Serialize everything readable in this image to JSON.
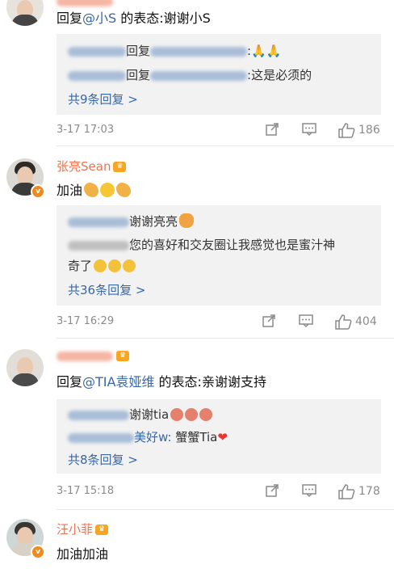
{
  "comments": [
    {
      "username": "",
      "text_prefix": "回复",
      "mention": "@小S",
      "text_suffix": " 的表态:谢谢小S",
      "replies": [
        {
          "name_label": "回复",
          "text": ":🙏🙏"
        },
        {
          "name_label": "回复",
          "text": ":这是必须的"
        }
      ],
      "more_link": "共9条回复 >",
      "timestamp": "3-17 17:03",
      "likes": "186"
    },
    {
      "username": "张亮Sean",
      "text": "加油",
      "replies": [
        {
          "text": "谢谢亮亮"
        },
        {
          "text": "您的喜好和交友圈让我感觉也是蜜汁神",
          "text2": "奇了"
        }
      ],
      "more_link": "共36条回复 >",
      "timestamp": "3-17 16:29",
      "likes": "404"
    },
    {
      "username": "",
      "text_prefix": "回复",
      "mention": "@TIA袁娅维",
      "text_suffix": " 的表态:亲谢谢支持",
      "replies": [
        {
          "text": "谢谢tia"
        },
        {
          "name_label": "美好w:",
          "text": " 蟹蟹Tia"
        }
      ],
      "more_link": "共8条回复 >",
      "timestamp": "3-17 15:18",
      "likes": "178"
    },
    {
      "username": "汪小菲",
      "text": "加油加油"
    }
  ],
  "icons": {
    "share": "share-icon",
    "comment": "comment-icon",
    "like": "thumbs-up-icon",
    "verified": "verified-v-badge",
    "crown": "member-crown-icon"
  },
  "colors": {
    "username": "#eb7350",
    "link": "#3a67a6",
    "reply_bg": "#f2f2f2",
    "meta": "#8a8a8a"
  }
}
